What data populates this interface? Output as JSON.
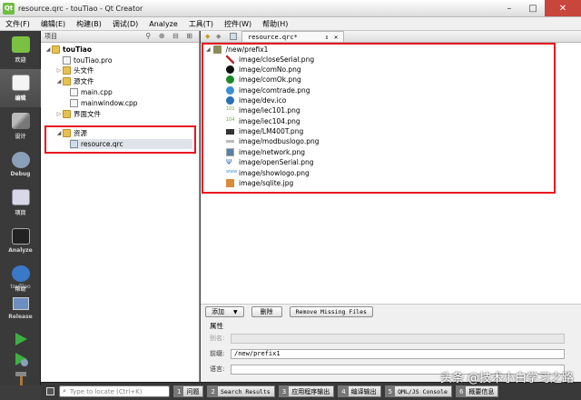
{
  "window": {
    "title": "resource.qrc - touTiao - Qt Creator"
  },
  "menu": [
    "文件(F)",
    "编辑(E)",
    "构建(B)",
    "调试(D)",
    "Analyze",
    "工具(T)",
    "控件(W)",
    "帮助(H)"
  ],
  "modes": [
    {
      "label": "欢迎",
      "icon": "qt-logo-icon",
      "active": false
    },
    {
      "label": "编辑",
      "icon": "edit-document-icon",
      "active": true
    },
    {
      "label": "设计",
      "icon": "design-pencil-icon",
      "active": false
    },
    {
      "label": "Debug",
      "icon": "debug-bug-icon",
      "active": false
    },
    {
      "label": "项目",
      "icon": "project-icon",
      "active": false
    },
    {
      "label": "Analyze",
      "icon": "analyze-icon",
      "active": false
    },
    {
      "label": "帮助",
      "icon": "help-icon",
      "active": false
    }
  ],
  "kit": {
    "name": "touTiao",
    "config": "Release"
  },
  "project_panel": {
    "header": "项目",
    "tree": [
      {
        "label": "touTiao",
        "depth": 0,
        "icon": "project-folder-icon",
        "bold": true
      },
      {
        "label": "touTiao.pro",
        "depth": 1,
        "icon": "pro-file-icon"
      },
      {
        "label": "头文件",
        "depth": 1,
        "icon": "folder-icon"
      },
      {
        "label": "源文件",
        "depth": 1,
        "icon": "folder-icon"
      },
      {
        "label": "main.cpp",
        "depth": 2,
        "icon": "cpp-file-icon"
      },
      {
        "label": "mainwindow.cpp",
        "depth": 2,
        "icon": "cpp-file-icon"
      },
      {
        "label": "界面文件",
        "depth": 1,
        "icon": "folder-icon"
      },
      {
        "label": "资源",
        "depth": 1,
        "icon": "resource-folder-icon"
      },
      {
        "label": "resource.qrc",
        "depth": 2,
        "icon": "qrc-file-icon",
        "selected": true
      }
    ]
  },
  "editor": {
    "tab": "resource.qrc*",
    "prefix": "/new/prefix1",
    "resources": [
      {
        "path": "image/closeSerial.png",
        "color": "#c0272d"
      },
      {
        "path": "image/comNo.png",
        "color": "#111111"
      },
      {
        "path": "image/comOk.png",
        "color": "#1d8a2b"
      },
      {
        "path": "image/comtrade.png",
        "color": "#3c8ed8"
      },
      {
        "path": "image/dev.ico",
        "color": "#2a6fb8"
      },
      {
        "path": "image/iec101.png",
        "color": "#6aa84f"
      },
      {
        "path": "image/iec104.png",
        "color": "#6aa84f"
      },
      {
        "path": "image/LM400T.png",
        "color": "#333333"
      },
      {
        "path": "image/modbuslogo.png",
        "color": "#888888"
      },
      {
        "path": "image/network.png",
        "color": "#5a7fa8"
      },
      {
        "path": "image/openSerial.png",
        "color": "#2d62c4"
      },
      {
        "path": "image/showlogo.png",
        "color": "#4d8fd6"
      },
      {
        "path": "image/sqlite.jpg",
        "color": "#d98a3a"
      }
    ],
    "buttons": {
      "add": "添加",
      "remove": "删除",
      "remove_missing": "Remove Missing Files"
    },
    "properties": {
      "title": "属性",
      "alias_label": "别名:",
      "alias_value": "",
      "prefix_label": "前缀:",
      "prefix_value": "/new/prefix1",
      "language_label": "语言:",
      "language_value": ""
    }
  },
  "statusbar": {
    "locate_placeholder": "Type to locate (Ctrl+K)",
    "tabs": [
      {
        "num": "1",
        "label": "问题"
      },
      {
        "num": "2",
        "label": "Search Results"
      },
      {
        "num": "3",
        "label": "应用程序输出"
      },
      {
        "num": "4",
        "label": "编译输出"
      },
      {
        "num": "5",
        "label": "QML/JS Console"
      },
      {
        "num": "6",
        "label": "概要信息"
      }
    ]
  },
  "watermark": "头条 @技术小白学习之路"
}
